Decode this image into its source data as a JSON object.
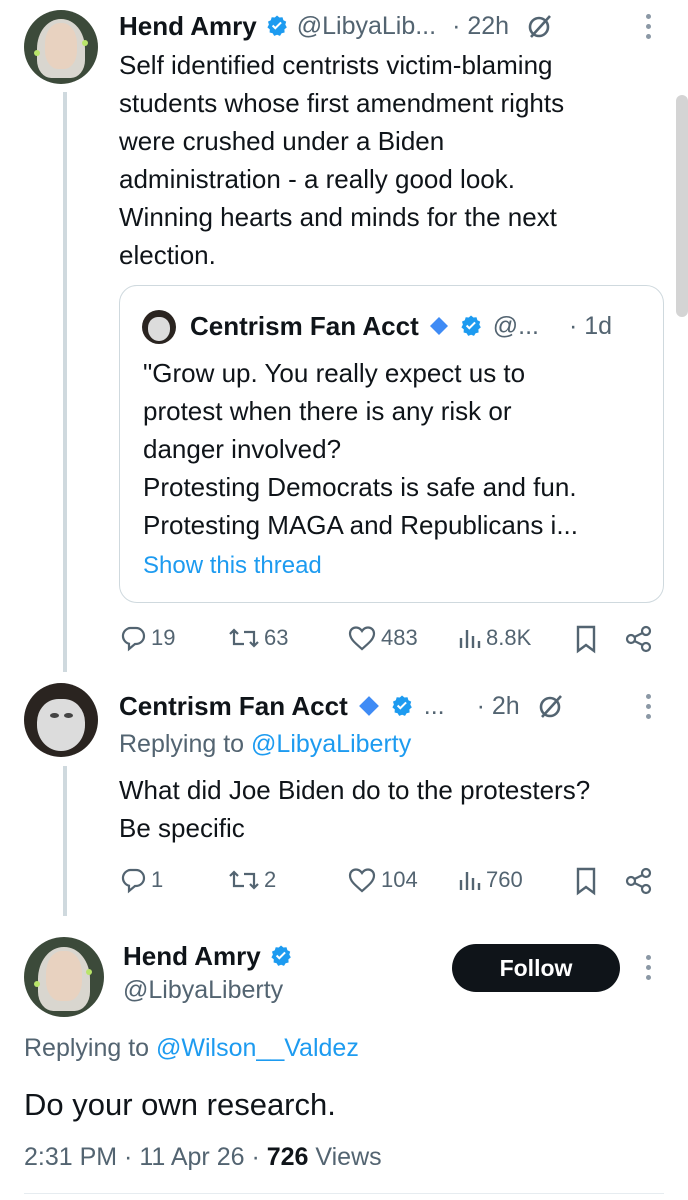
{
  "tweet1": {
    "name": "Hend Amry",
    "handle": "@LibyaLib...",
    "time": "· 22h",
    "text": "Self identified centrists victim-blaming\nstudents whose first amendment rights\nwere crushed under a Biden\nadministration - a really good look.\nWinning hearts and minds for the next\nelection.",
    "quote": {
      "name": "Centrism Fan Acct",
      "handle": "@...",
      "time": "· 1d",
      "text": "\"Grow up. You really expect us to\nprotest when there is any risk or\ndanger involved?\nProtesting Democrats is safe and fun.\nProtesting MAGA and Republicans i...",
      "show_thread": "Show this thread"
    },
    "actions": {
      "replies": "19",
      "reposts": "63",
      "likes": "483",
      "views": "8.8K"
    }
  },
  "tweet2": {
    "name": "Centrism Fan Acct",
    "handle": "...",
    "time": "· 2h",
    "replying_prefix": "Replying to ",
    "replying_handle": "@LibyaLiberty",
    "text": "What did Joe Biden do to the protesters?\nBe specific",
    "actions": {
      "replies": "1",
      "reposts": "2",
      "likes": "104",
      "views": "760"
    }
  },
  "main_tweet": {
    "name": "Hend Amry",
    "handle": "@LibyaLiberty",
    "follow_label": "Follow",
    "replying_prefix": "Replying to ",
    "replying_handle": "@Wilson__Valdez",
    "text": "Do your own research.",
    "timestamp": "2:31 PM · 11 Apr 26 · ",
    "views_count": "726",
    "views_label": " Views"
  },
  "colors": {
    "accent": "#1d9bf0",
    "text": "#0f1419",
    "muted": "#536471",
    "border": "#cfd9de",
    "verified_gold": "#1d9bf0"
  },
  "icons": [
    "reply-icon",
    "repost-icon",
    "like-icon",
    "views-icon",
    "bookmark-icon",
    "share-icon",
    "grok-icon",
    "more-icon",
    "verified-icon",
    "affiliate-diamond-icon"
  ]
}
